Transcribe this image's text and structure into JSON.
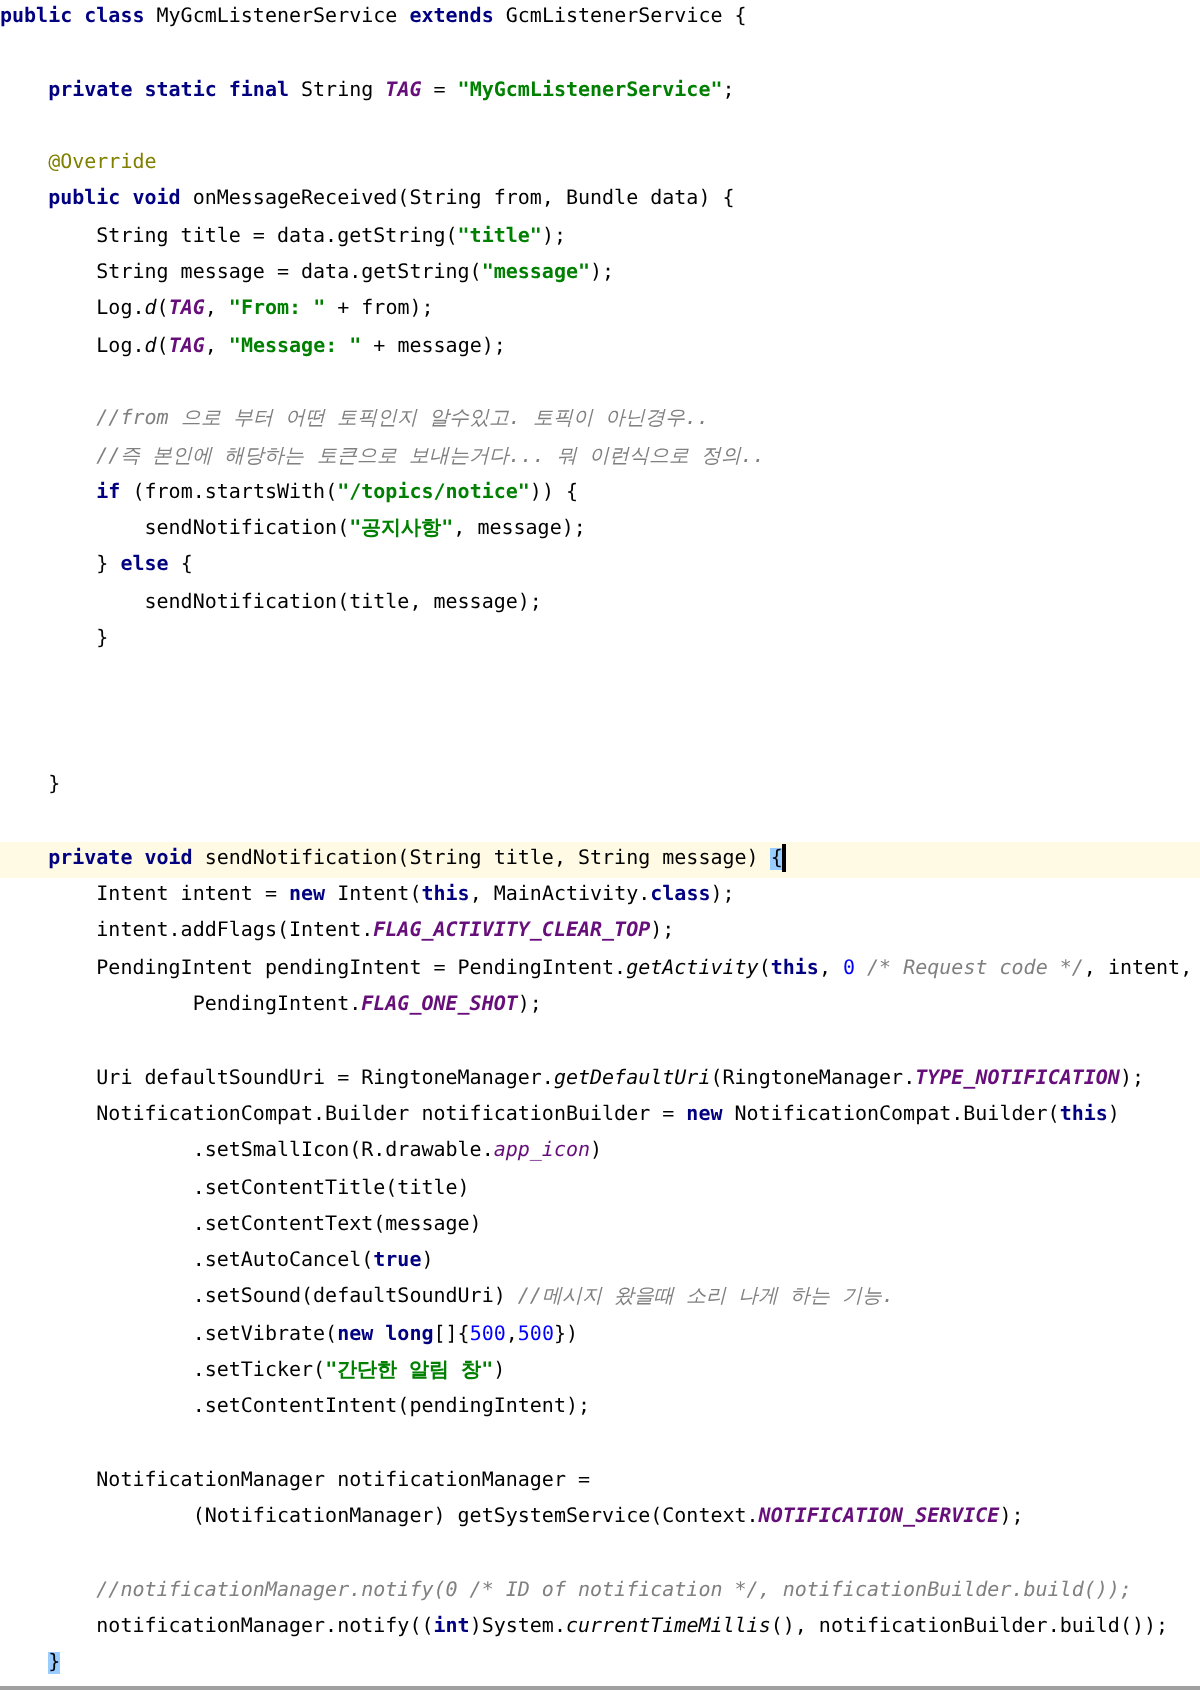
{
  "editor": {
    "lines": [
      {
        "tokens": [
          {
            "text": "public class",
            "kind": "keyword"
          },
          {
            "text": " MyGcmListenerService ",
            "kind": "plain"
          },
          {
            "text": "extends",
            "kind": "keyword"
          },
          {
            "text": " GcmListenerService {",
            "kind": "plain"
          }
        ]
      },
      {
        "blank": true
      },
      {
        "tokens": [
          {
            "text": "    private static final",
            "kind": "keyword"
          },
          {
            "text": " String ",
            "kind": "plain"
          },
          {
            "text": "TAG",
            "kind": "constant"
          },
          {
            "text": " = ",
            "kind": "plain"
          },
          {
            "text": "\"MyGcmListenerService\"",
            "kind": "string"
          },
          {
            "text": ";",
            "kind": "plain"
          }
        ]
      },
      {
        "blank": true
      },
      {
        "tokens": [
          {
            "text": "    @Override",
            "kind": "annotation"
          }
        ]
      },
      {
        "tokens": [
          {
            "text": "    public void",
            "kind": "keyword"
          },
          {
            "text": " onMessageReceived(String from, Bundle data) {",
            "kind": "plain"
          }
        ]
      },
      {
        "tokens": [
          {
            "text": "        String title = data.getString(",
            "kind": "plain"
          },
          {
            "text": "\"title\"",
            "kind": "string"
          },
          {
            "text": ");",
            "kind": "plain"
          }
        ]
      },
      {
        "tokens": [
          {
            "text": "        String message = data.getString(",
            "kind": "plain"
          },
          {
            "text": "\"message\"",
            "kind": "string"
          },
          {
            "text": ");",
            "kind": "plain"
          }
        ]
      },
      {
        "tokens": [
          {
            "text": "        Log.",
            "kind": "plain"
          },
          {
            "text": "d",
            "kind": "static"
          },
          {
            "text": "(",
            "kind": "plain"
          },
          {
            "text": "TAG",
            "kind": "constant"
          },
          {
            "text": ", ",
            "kind": "plain"
          },
          {
            "text": "\"From: \"",
            "kind": "string"
          },
          {
            "text": " + from);",
            "kind": "plain"
          }
        ]
      },
      {
        "tokens": [
          {
            "text": "        Log.",
            "kind": "plain"
          },
          {
            "text": "d",
            "kind": "static"
          },
          {
            "text": "(",
            "kind": "plain"
          },
          {
            "text": "TAG",
            "kind": "constant"
          },
          {
            "text": ", ",
            "kind": "plain"
          },
          {
            "text": "\"Message: \"",
            "kind": "string"
          },
          {
            "text": " + message);",
            "kind": "plain"
          }
        ]
      },
      {
        "blank": true
      },
      {
        "tokens": [
          {
            "text": "        //from 으로 부터 어떤 토픽인지 알수있고. 토픽이 아닌경우..",
            "kind": "comment"
          }
        ]
      },
      {
        "tokens": [
          {
            "text": "        //즉 본인에 해당하는 토큰으로 보내는거다... 뭐 이런식으로 정의..",
            "kind": "comment"
          }
        ]
      },
      {
        "tokens": [
          {
            "text": "        if",
            "kind": "keyword"
          },
          {
            "text": " (from.startsWith(",
            "kind": "plain"
          },
          {
            "text": "\"/topics/notice\"",
            "kind": "string"
          },
          {
            "text": ")) {",
            "kind": "plain"
          }
        ]
      },
      {
        "tokens": [
          {
            "text": "            sendNotification(",
            "kind": "plain"
          },
          {
            "text": "\"공지사항\"",
            "kind": "string"
          },
          {
            "text": ", message);",
            "kind": "plain"
          }
        ]
      },
      {
        "tokens": [
          {
            "text": "        } ",
            "kind": "plain"
          },
          {
            "text": "else",
            "kind": "keyword"
          },
          {
            "text": " {",
            "kind": "plain"
          }
        ]
      },
      {
        "tokens": [
          {
            "text": "            sendNotification(title, message);",
            "kind": "plain"
          }
        ]
      },
      {
        "tokens": [
          {
            "text": "        }",
            "kind": "plain"
          }
        ]
      },
      {
        "blank": true
      },
      {
        "blank": true
      },
      {
        "blank": true
      },
      {
        "tokens": [
          {
            "text": "    }",
            "kind": "plain"
          }
        ]
      },
      {
        "blank": true
      },
      {
        "current": true,
        "tokens": [
          {
            "text": "    private void",
            "kind": "keyword"
          },
          {
            "text": " sendNotification(String title, String message) ",
            "kind": "plain"
          },
          {
            "text": "{",
            "kind": "match"
          }
        ]
      },
      {
        "tokens": [
          {
            "text": "        Intent intent = ",
            "kind": "plain"
          },
          {
            "text": "new",
            "kind": "keyword"
          },
          {
            "text": " Intent(",
            "kind": "plain"
          },
          {
            "text": "this",
            "kind": "keyword"
          },
          {
            "text": ", MainActivity.",
            "kind": "plain"
          },
          {
            "text": "class",
            "kind": "keyword"
          },
          {
            "text": ");",
            "kind": "plain"
          }
        ]
      },
      {
        "tokens": [
          {
            "text": "        intent.addFlags(Intent.",
            "kind": "plain"
          },
          {
            "text": "FLAG_ACTIVITY_CLEAR_TOP",
            "kind": "constant"
          },
          {
            "text": ");",
            "kind": "plain"
          }
        ]
      },
      {
        "tokens": [
          {
            "text": "        PendingIntent pendingIntent = PendingIntent.",
            "kind": "plain"
          },
          {
            "text": "getActivity",
            "kind": "static"
          },
          {
            "text": "(",
            "kind": "plain"
          },
          {
            "text": "this",
            "kind": "keyword"
          },
          {
            "text": ", ",
            "kind": "plain"
          },
          {
            "text": "0",
            "kind": "number"
          },
          {
            "text": " /* Request code */",
            "kind": "comment"
          },
          {
            "text": ", intent,",
            "kind": "plain"
          }
        ]
      },
      {
        "tokens": [
          {
            "text": "                PendingIntent.",
            "kind": "plain"
          },
          {
            "text": "FLAG_ONE_SHOT",
            "kind": "constant"
          },
          {
            "text": ");",
            "kind": "plain"
          }
        ]
      },
      {
        "blank": true
      },
      {
        "tokens": [
          {
            "text": "        Uri defaultSoundUri = RingtoneManager.",
            "kind": "plain"
          },
          {
            "text": "getDefaultUri",
            "kind": "static"
          },
          {
            "text": "(RingtoneManager.",
            "kind": "plain"
          },
          {
            "text": "TYPE_NOTIFICATION",
            "kind": "constant"
          },
          {
            "text": ");",
            "kind": "plain"
          }
        ]
      },
      {
        "tokens": [
          {
            "text": "        NotificationCompat.Builder notificationBuilder = ",
            "kind": "plain"
          },
          {
            "text": "new",
            "kind": "keyword"
          },
          {
            "text": " NotificationCompat.Builder(",
            "kind": "plain"
          },
          {
            "text": "this",
            "kind": "keyword"
          },
          {
            "text": ")",
            "kind": "plain"
          }
        ]
      },
      {
        "tokens": [
          {
            "text": "                .setSmallIcon(R.drawable.",
            "kind": "plain"
          },
          {
            "text": "app_icon",
            "kind": "field"
          },
          {
            "text": ")",
            "kind": "plain"
          }
        ]
      },
      {
        "tokens": [
          {
            "text": "                .setContentTitle(title)",
            "kind": "plain"
          }
        ]
      },
      {
        "tokens": [
          {
            "text": "                .setContentText(message)",
            "kind": "plain"
          }
        ]
      },
      {
        "tokens": [
          {
            "text": "                .setAutoCancel(",
            "kind": "plain"
          },
          {
            "text": "true",
            "kind": "keyword"
          },
          {
            "text": ")",
            "kind": "plain"
          }
        ]
      },
      {
        "tokens": [
          {
            "text": "                .setSound(defaultSoundUri) ",
            "kind": "plain"
          },
          {
            "text": "//메시지 왔을때 소리 나게 하는 기능.",
            "kind": "comment"
          }
        ]
      },
      {
        "tokens": [
          {
            "text": "                .setVibrate(",
            "kind": "plain"
          },
          {
            "text": "new long",
            "kind": "keyword"
          },
          {
            "text": "[]{",
            "kind": "plain"
          },
          {
            "text": "500",
            "kind": "number"
          },
          {
            "text": ",",
            "kind": "plain"
          },
          {
            "text": "500",
            "kind": "number"
          },
          {
            "text": "})",
            "kind": "plain"
          }
        ]
      },
      {
        "tokens": [
          {
            "text": "                .setTicker(",
            "kind": "plain"
          },
          {
            "text": "\"간단한 알림 창\"",
            "kind": "string"
          },
          {
            "text": ")",
            "kind": "plain"
          }
        ]
      },
      {
        "tokens": [
          {
            "text": "                .setContentIntent(pendingIntent);",
            "kind": "plain"
          }
        ]
      },
      {
        "blank": true
      },
      {
        "tokens": [
          {
            "text": "        NotificationManager notificationManager =",
            "kind": "plain"
          }
        ]
      },
      {
        "tokens": [
          {
            "text": "                (NotificationManager) getSystemService(Context.",
            "kind": "plain"
          },
          {
            "text": "NOTIFICATION_SERVICE",
            "kind": "constant"
          },
          {
            "text": ");",
            "kind": "plain"
          }
        ]
      },
      {
        "blank": true
      },
      {
        "tokens": [
          {
            "text": "        //notificationManager.notify(0 /* ID of notification */, notificationBuilder.build());",
            "kind": "comment"
          }
        ]
      },
      {
        "tokens": [
          {
            "text": "        notificationManager.notify((",
            "kind": "plain"
          },
          {
            "text": "int",
            "kind": "keyword"
          },
          {
            "text": ")System.",
            "kind": "plain"
          },
          {
            "text": "currentTimeMillis",
            "kind": "static"
          },
          {
            "text": "(), notificationBuilder.build());",
            "kind": "plain"
          }
        ]
      },
      {
        "tokens": [
          {
            "text": "    }",
            "kind": "match"
          }
        ]
      }
    ]
  }
}
